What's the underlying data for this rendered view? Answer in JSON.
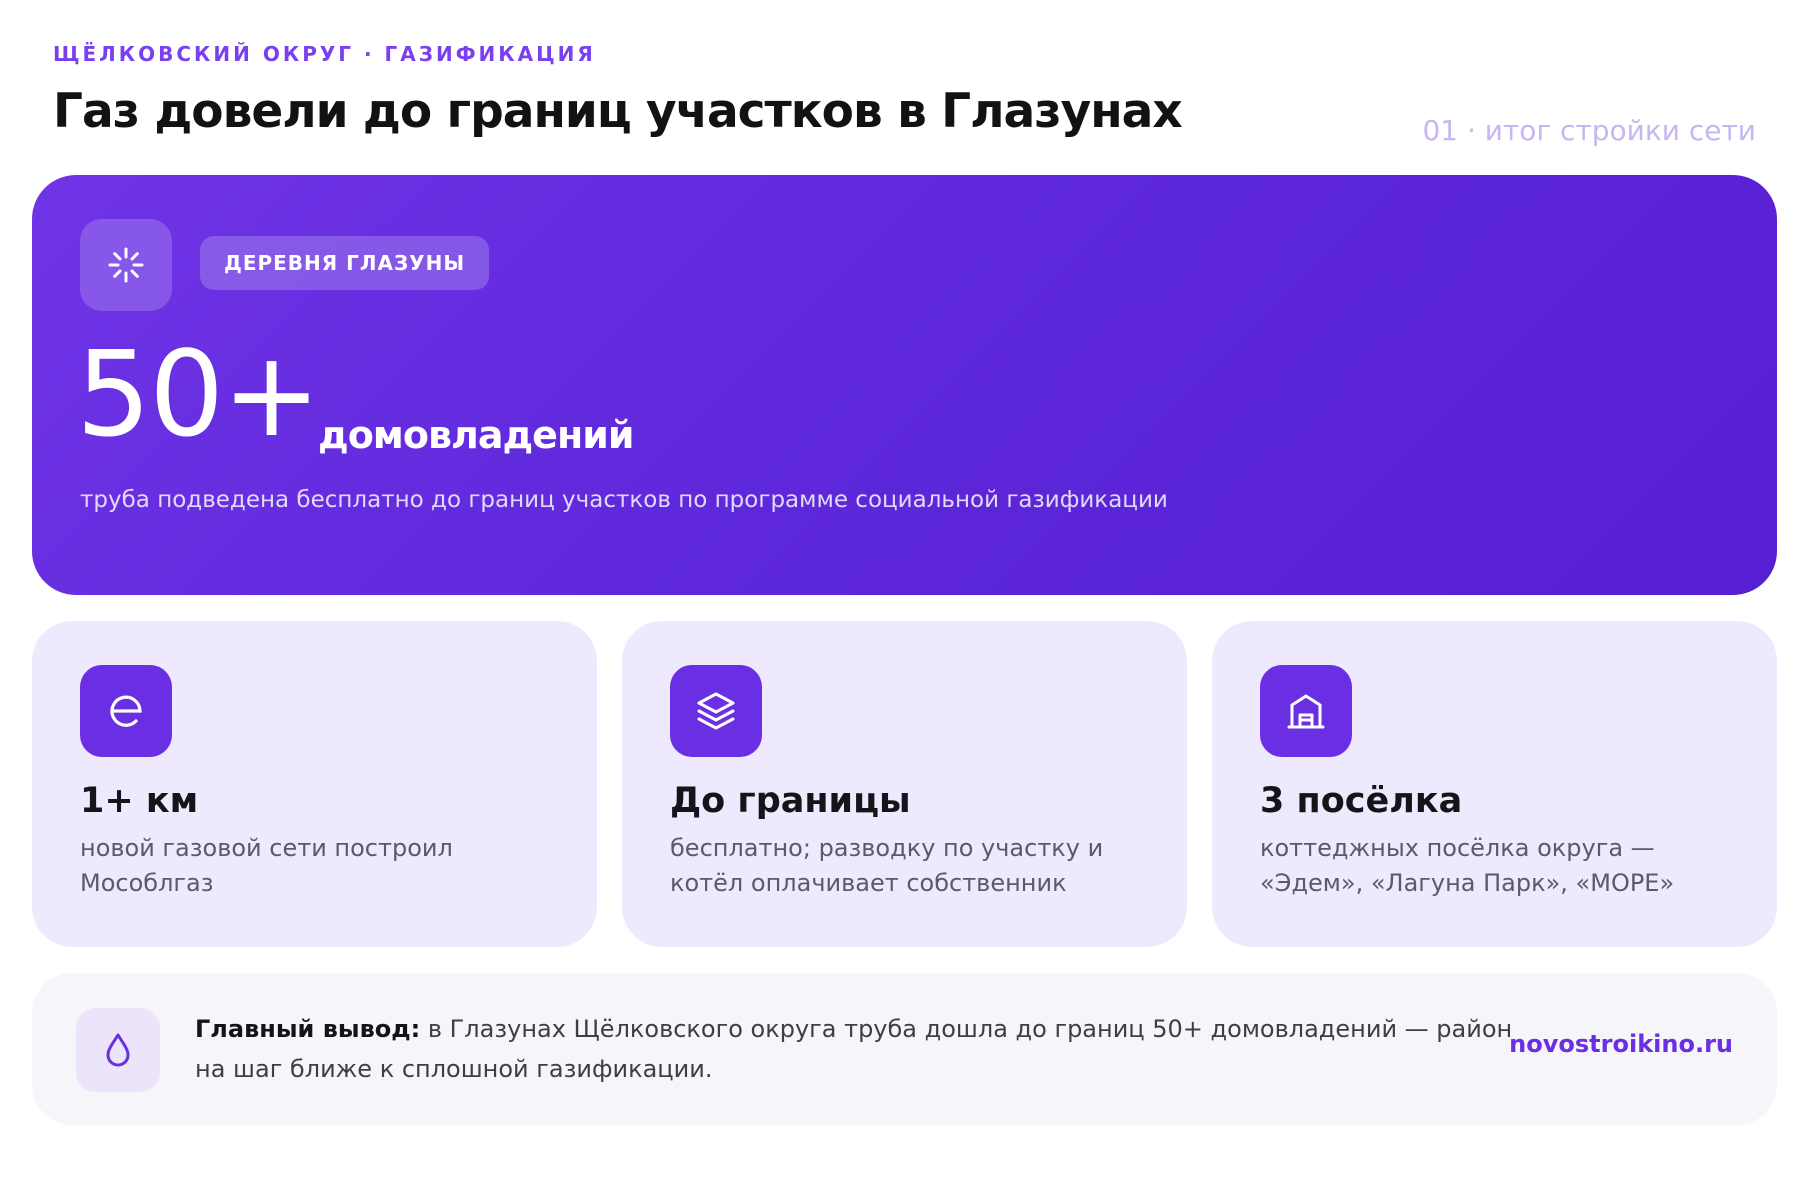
{
  "header": {
    "kicker": "ЩЁЛКОВСКИЙ ОКРУГ · ГАЗИФИКАЦИЯ",
    "title": "Газ довели до границ участков в Глазунах",
    "meta": "01 · итог стройки сети"
  },
  "hero": {
    "icon": "sparkle-icon",
    "pill": "ДЕРЕВНЯ ГЛАЗУНЫ",
    "big_number": "50+",
    "unit": "домовладений",
    "description": "труба подведена бесплатно до границ участков по программе социальной газификации"
  },
  "cards": [
    {
      "icon": "pipe-network-icon",
      "title": "1+ км",
      "text": "новой газовой сети построил Мособлгаз"
    },
    {
      "icon": "layers-icon",
      "title": "До границы",
      "text": "бесплатно; разводку по участку и котёл оплачивает собственник"
    },
    {
      "icon": "house-icon",
      "title": "3 посёлка",
      "text": "коттеджных посёлка округа — «Эдем», «Лагуна Парк», «МОРЕ»"
    }
  ],
  "footer": {
    "icon": "drop-icon",
    "lead": "Главный вывод:",
    "text": " в Глазунах Щёлковского округа труба дошла до границ 50+ домовладений — район на шаг ближе к сплошной газификации.",
    "site": "novostroikino.ru"
  },
  "colors": {
    "accent": "#6a2fe2",
    "hero_bg": "#5e27da",
    "card_bg": "#efe9fd",
    "kicker": "#7a3ff0"
  }
}
